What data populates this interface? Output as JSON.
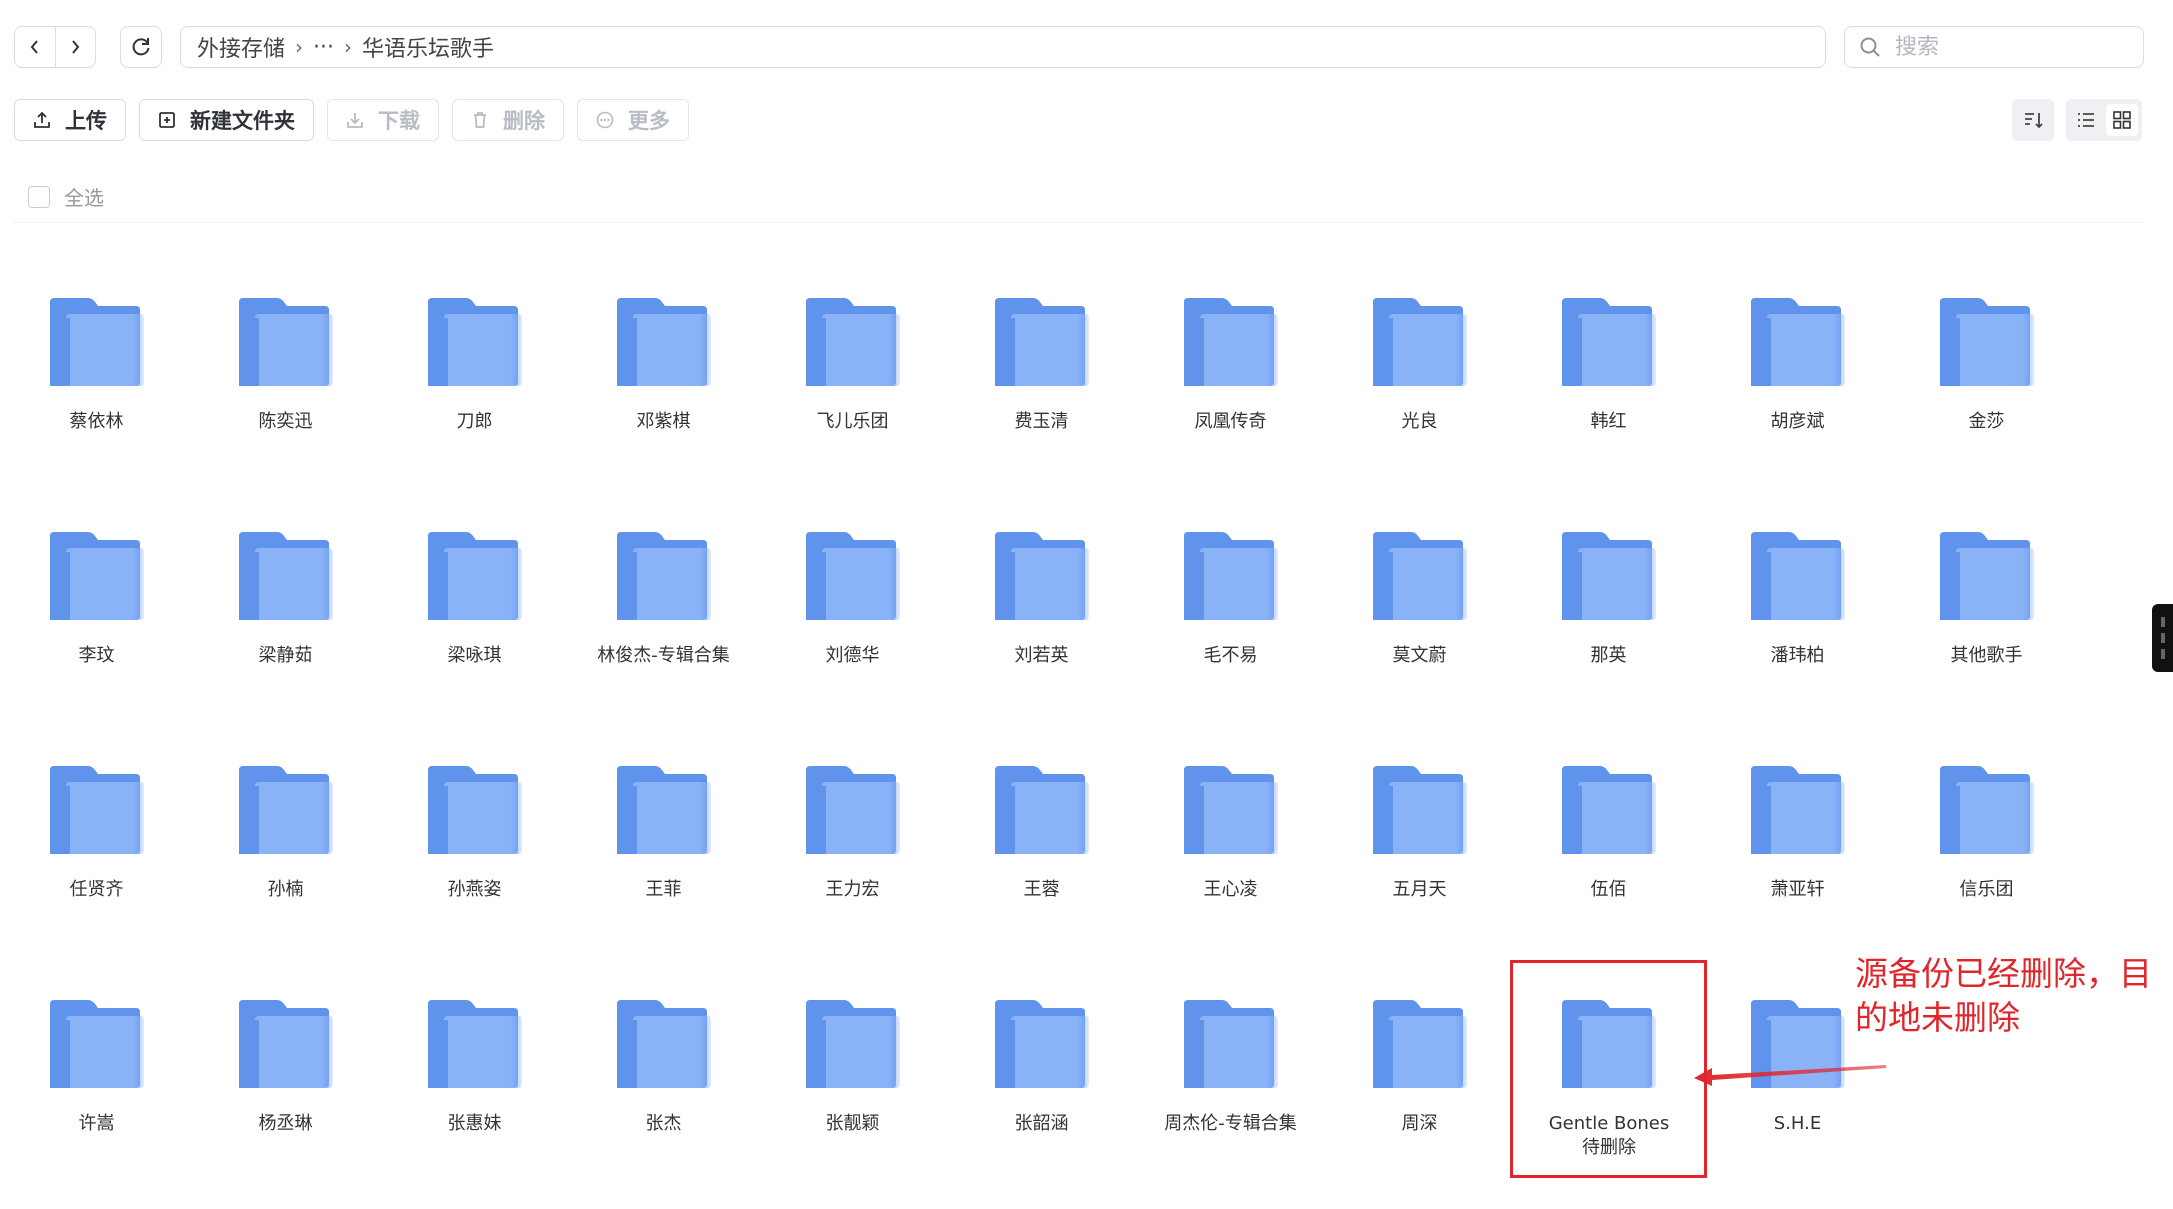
{
  "nav": {
    "back_icon": "chevron-left-icon",
    "forward_icon": "chevron-right-icon",
    "refresh_icon": "refresh-icon"
  },
  "breadcrumb": {
    "root": "外接存储",
    "ellipsis": "···",
    "current": "华语乐坛歌手"
  },
  "search": {
    "placeholder": "搜索",
    "icon": "search-icon"
  },
  "toolbar": {
    "upload": "上传",
    "new_folder": "新建文件夹",
    "download": "下载",
    "delete": "删除",
    "more": "更多"
  },
  "select_all": "全选",
  "folders": [
    "蔡依林",
    "陈奕迅",
    "刀郎",
    "邓紫棋",
    "飞儿乐团",
    "费玉清",
    "凤凰传奇",
    "光良",
    "韩红",
    "胡彦斌",
    "金莎",
    "李玟",
    "梁静茹",
    "梁咏琪",
    "林俊杰-专辑合集",
    "刘德华",
    "刘若英",
    "毛不易",
    "莫文蔚",
    "那英",
    "潘玮柏",
    "其他歌手",
    "任贤齐",
    "孙楠",
    "孙燕姿",
    "王菲",
    "王力宏",
    "王蓉",
    "王心凌",
    "五月天",
    "伍佰",
    "萧亚轩",
    "信乐团",
    "许嵩",
    "杨丞琳",
    "张惠妹",
    "张杰",
    "张靓颖",
    "张韶涵",
    "周杰伦-专辑合集",
    "周深",
    "Gentle Bones待删除",
    "S.H.E"
  ],
  "annotation": {
    "text": "源备份已经删除，目的地未删除",
    "highlight_folder": "Gentle Bones待删除"
  },
  "colors": {
    "folder_back": "#5f93ec",
    "folder_front": "#8ab2f7",
    "annotation_red": "#e0262b"
  }
}
